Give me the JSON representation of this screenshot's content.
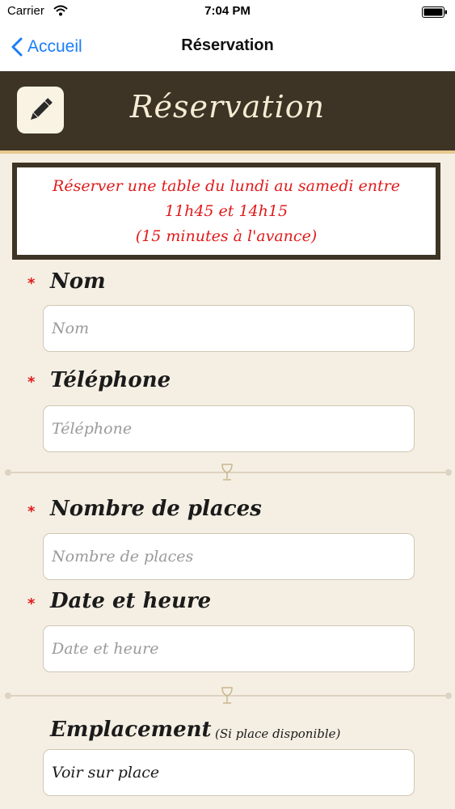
{
  "status_bar": {
    "carrier": "Carrier",
    "time": "7:04 PM",
    "icons": [
      "wifi-icon",
      "battery-icon"
    ]
  },
  "nav_bar": {
    "back_label": "Accueil",
    "title": "Réservation",
    "accent_color": "#1a7ef7"
  },
  "header": {
    "title": "Réservation",
    "icon": "pencil-icon",
    "background_color": "#3d3425"
  },
  "notice": {
    "lines": [
      "Réserver une table du lundi au samedi entre",
      "11h45 et 14h15",
      "(15 minutes à l'avance)"
    ],
    "text_color": "#e01b1b"
  },
  "form": {
    "name": {
      "label": "Nom",
      "required": true,
      "placeholder": "Nom",
      "value": ""
    },
    "phone": {
      "label": "Téléphone",
      "required": true,
      "placeholder": "Téléphone",
      "value": ""
    },
    "seats": {
      "label": "Nombre de places",
      "required": true,
      "placeholder": "Nombre de places",
      "value": ""
    },
    "datetime": {
      "label": "Date et heure",
      "required": true,
      "placeholder": "Date et heure",
      "value": ""
    },
    "location": {
      "label": "Emplacement",
      "note": "(Si place disponible)",
      "value": "Voir sur place"
    },
    "required_marker": "*"
  }
}
